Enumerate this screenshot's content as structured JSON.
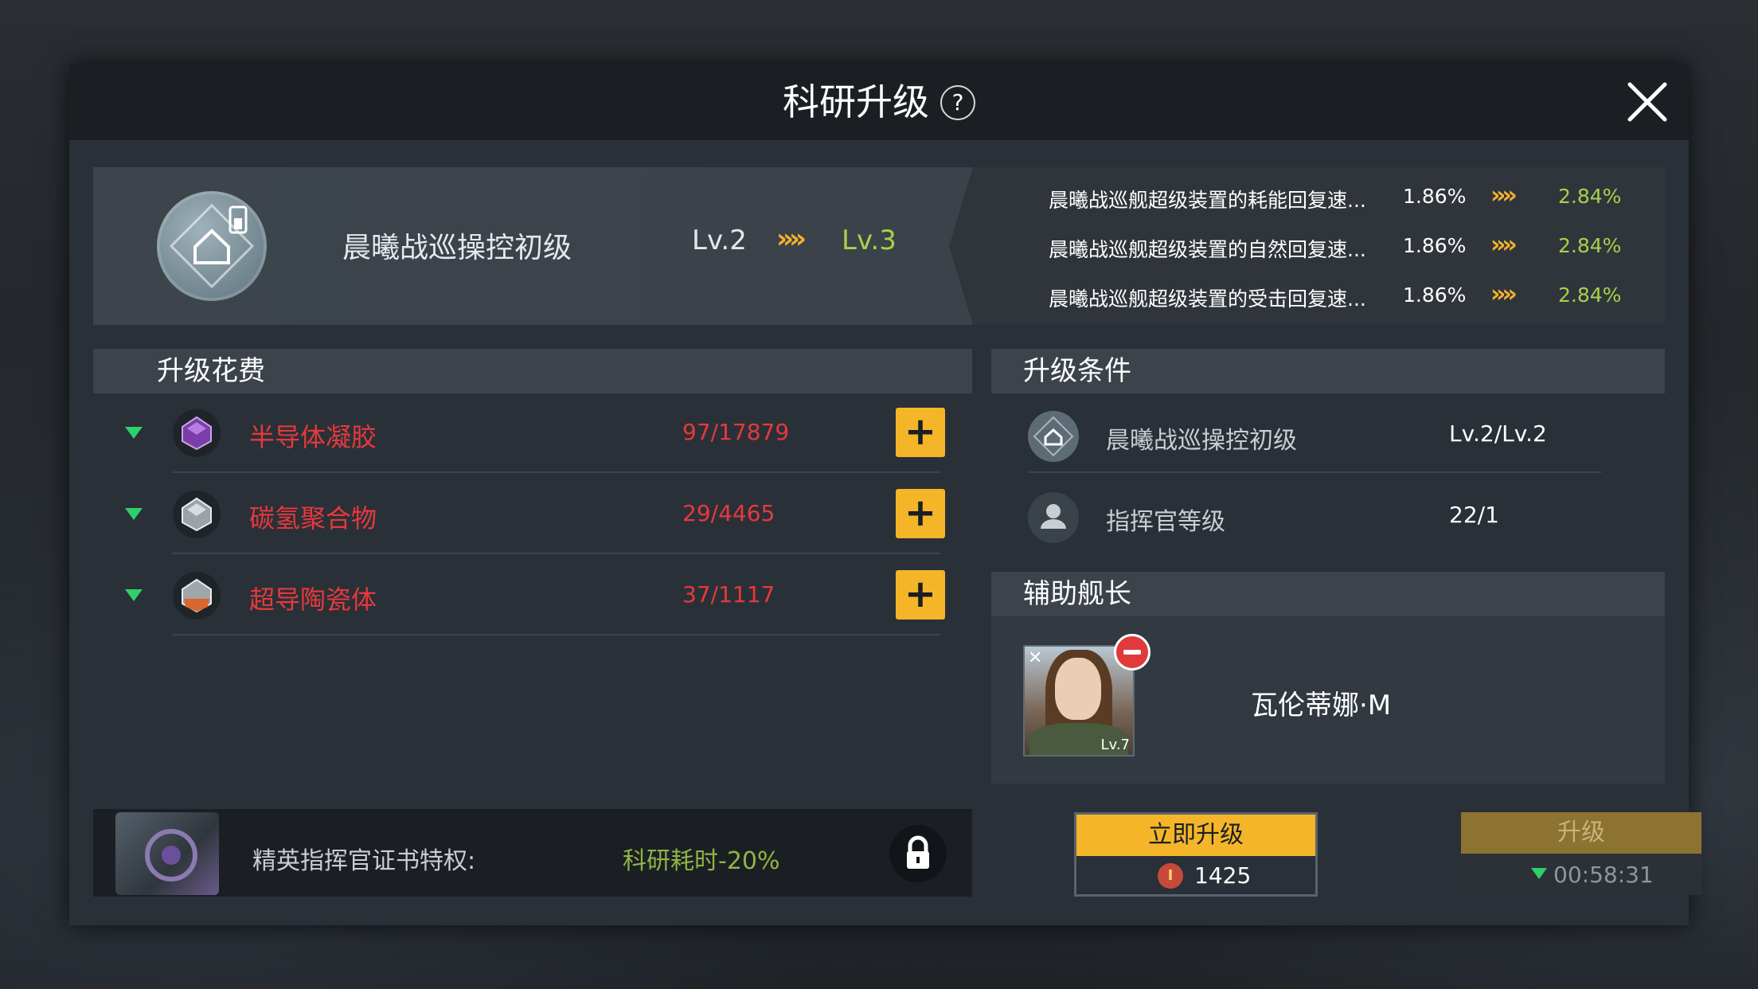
{
  "title": "科研升级",
  "help_glyph": "?",
  "tech": {
    "name": "晨曦战巡操控初级",
    "level_from": "Lv.2",
    "level_to": "Lv.3",
    "arrow": "»»"
  },
  "stats": [
    {
      "name": "晨曦战巡舰超级装置的耗能回复速...",
      "from": "1.86%",
      "to": "2.84%"
    },
    {
      "name": "晨曦战巡舰超级装置的自然回复速...",
      "from": "1.86%",
      "to": "2.84%"
    },
    {
      "name": "晨曦战巡舰超级装置的受击回复速...",
      "from": "1.86%",
      "to": "2.84%"
    }
  ],
  "cost": {
    "header": "升级花费",
    "items": [
      {
        "name": "半导体凝胶",
        "count": "97/17879",
        "icon": "purple-crystal-icon"
      },
      {
        "name": "碳氢聚合物",
        "count": "29/4465",
        "icon": "white-crystal-icon"
      },
      {
        "name": "超导陶瓷体",
        "count": "37/1117",
        "icon": "orange-crystal-icon"
      }
    ],
    "plus_label": "+"
  },
  "perk": {
    "label": "精英指挥官证书特权:",
    "value": "科研耗时-20%"
  },
  "conditions": {
    "header": "升级条件",
    "items": [
      {
        "name": "晨曦战巡操控初级",
        "value": "Lv.2/Lv.2"
      },
      {
        "name": "指挥官等级",
        "value": "22/1"
      }
    ]
  },
  "captain": {
    "header": "辅助舰长",
    "name": "瓦伦蒂娜·M",
    "level": "Lv.7"
  },
  "buttons": {
    "instant_label": "立即升级",
    "instant_cost": "1425",
    "coin_glyph": "I",
    "upgrade_label": "升级",
    "upgrade_time": "00:58:31"
  },
  "colors": {
    "accent_gold": "#f4b528",
    "level_green": "#a7d04a",
    "warning_red": "#e6393c"
  }
}
